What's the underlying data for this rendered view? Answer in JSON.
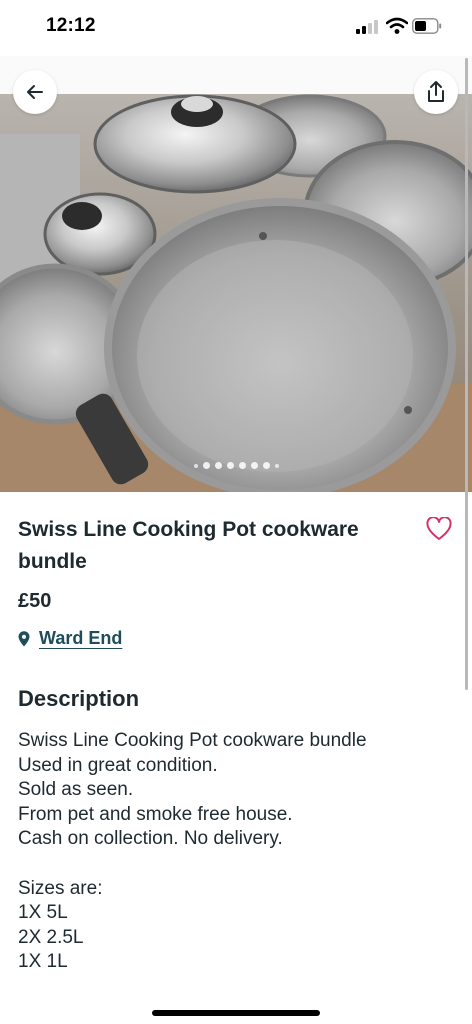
{
  "status_bar": {
    "time": "12:12",
    "signal_icon": "cellular-signal-icon",
    "wifi_icon": "wifi-icon",
    "battery_icon": "battery-icon"
  },
  "header": {
    "back_icon": "back-arrow-icon",
    "share_icon": "share-icon",
    "carousel": {
      "dot_count": 8,
      "active_index": 1
    }
  },
  "listing": {
    "title": "Swiss Line Cooking Pot cookware bundle",
    "price": "£50",
    "favourite_icon": "heart-icon",
    "location": {
      "icon": "map-pin-icon",
      "label": "Ward End"
    }
  },
  "description": {
    "heading": "Description",
    "lines": [
      "Swiss Line Cooking Pot cookware bundle",
      "Used in great condition.",
      "Sold as seen.",
      "From pet and smoke free house.",
      "Cash on collection. No delivery.",
      "",
      "Sizes are:",
      "1X 5L",
      "2X 2.5L",
      "1X 1L"
    ]
  },
  "colors": {
    "text": "#1f2a30",
    "link": "#1f4d5a",
    "heart": "#d6336c"
  }
}
